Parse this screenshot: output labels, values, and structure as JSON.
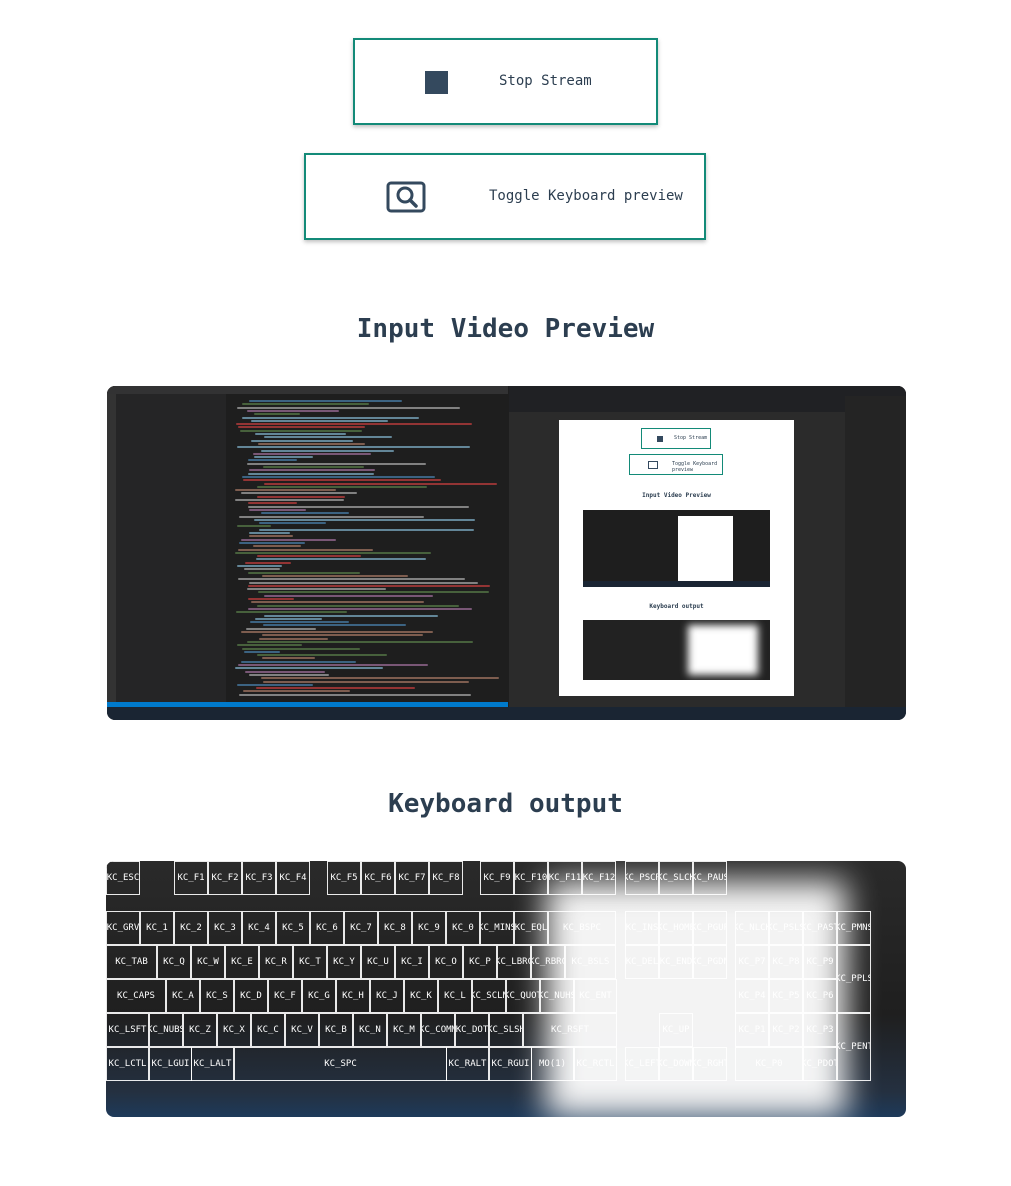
{
  "controls": {
    "stop_stream_label": "Stop Stream",
    "toggle_keyboard_label": "Toggle Keyboard preview"
  },
  "sections": {
    "video_title": "Input Video Preview",
    "keyboard_title": "Keyboard output"
  },
  "video_preview": {
    "mini_page": {
      "stop_label": "Stop Stream",
      "toggle_label": "Toggle Keyboard preview",
      "video_title": "Input Video Preview",
      "keyboard_title": "Keyboard output"
    }
  },
  "keyboard": {
    "rows": [
      [
        "KC_ESC",
        "KC_F1",
        "KC_F2",
        "KC_F3",
        "KC_F4",
        "KC_F5",
        "KC_F6",
        "KC_F7",
        "KC_F8",
        "KC_F9",
        "KC_F10",
        "KC_F11",
        "KC_F12",
        "KC_PSCR",
        "KC_SLCK",
        "KC_PAUS"
      ],
      [
        "KC_GRV",
        "KC_1",
        "KC_2",
        "KC_3",
        "KC_4",
        "KC_5",
        "KC_6",
        "KC_7",
        "KC_8",
        "KC_9",
        "KC_0",
        "KC_MINS",
        "KC_EQL",
        "KC_BSPC",
        "KC_INS",
        "KC_HOME",
        "KC_PGUP",
        "KC_NLCK",
        "KC_PSLS",
        "KC_PAST",
        "KC_PMNS"
      ],
      [
        "KC_TAB",
        "KC_Q",
        "KC_W",
        "KC_E",
        "KC_R",
        "KC_T",
        "KC_Y",
        "KC_U",
        "KC_I",
        "KC_O",
        "KC_P",
        "KC_LBRC",
        "KC_RBRC",
        "KC_BSLS",
        "KC_DEL",
        "KC_END",
        "KC_PGDN",
        "KC_P7",
        "KC_P8",
        "KC_P9",
        "KC_PPLS"
      ],
      [
        "KC_CAPS",
        "KC_A",
        "KC_S",
        "KC_D",
        "KC_F",
        "KC_G",
        "KC_H",
        "KC_J",
        "KC_K",
        "KC_L",
        "KC_SCLN",
        "KC_QUOT",
        "KC_NUHS",
        "KC_ENT",
        "KC_P4",
        "KC_P5",
        "KC_P6"
      ],
      [
        "KC_LSFT",
        "KC_NUBS",
        "KC_Z",
        "KC_X",
        "KC_C",
        "KC_V",
        "KC_B",
        "KC_N",
        "KC_M",
        "KC_COMM",
        "KC_DOT",
        "KC_SLSH",
        "KC_RSFT",
        "KC_UP",
        "KC_P1",
        "KC_P2",
        "KC_P3",
        "KC_PENT"
      ],
      [
        "KC_LCTL",
        "KC_LGUI",
        "KC_LALT",
        "KC_SPC",
        "KC_RALT",
        "KC_RGUI",
        "MO(1)",
        "KC_RCTL",
        "KC_LEFT",
        "KC_DOWN",
        "KC_RGHT",
        "KC_P0",
        "KC_PDOT"
      ]
    ]
  }
}
